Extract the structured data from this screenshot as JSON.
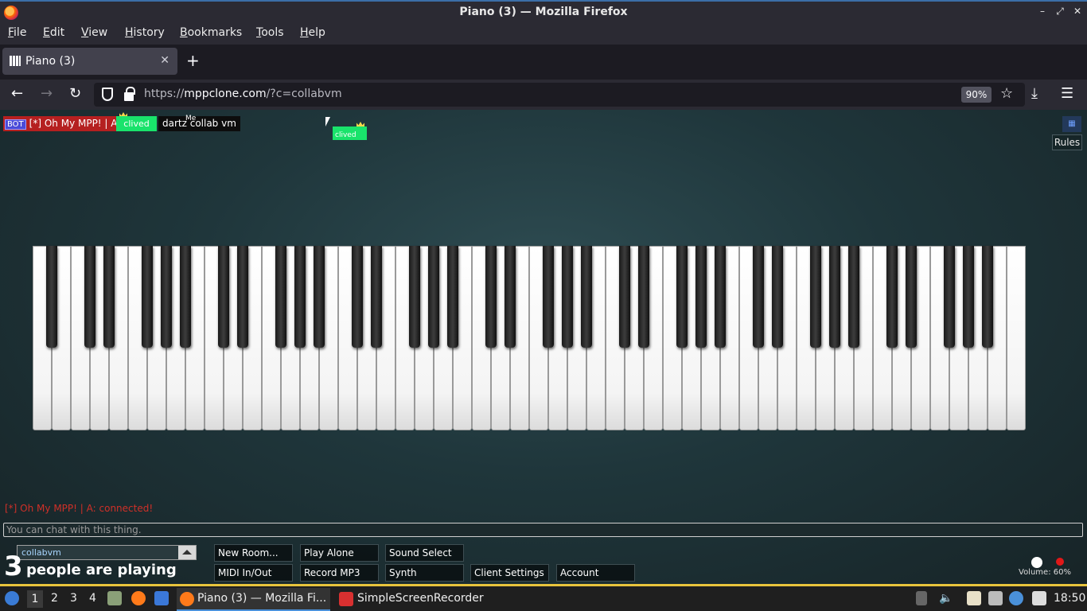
{
  "window": {
    "title": "Piano (3) — Mozilla Firefox"
  },
  "menu": [
    "File",
    "Edit",
    "View",
    "History",
    "Bookmarks",
    "Tools",
    "Help"
  ],
  "tab": {
    "label": "Piano (3)"
  },
  "address": {
    "scheme": "https://",
    "host": "mppclone.com",
    "path": "/?c=collabvm",
    "zoom": "90%"
  },
  "page": {
    "participants": {
      "bot_badge": "BOT",
      "bot_name": "[*] Oh My MPP! | A",
      "user2": "clived",
      "user3": "dartz collab vm",
      "me_label": "Me",
      "cursor_name": "clived"
    },
    "rules_label": "Rules",
    "chat": {
      "last_message_name": "[*] Oh My MPP! | A:",
      "last_message_text": "connected!",
      "input_placeholder": "You can chat with this thing."
    },
    "room": {
      "selected": "collabvm"
    },
    "players": {
      "count": "3",
      "text": "people are playing"
    },
    "buttons": {
      "new_room": "New Room...",
      "play_alone": "Play Alone",
      "sound_select": "Sound Select",
      "midi": "MIDI In/Out",
      "record": "Record MP3",
      "synth": "Synth",
      "client_settings": "Client Settings",
      "account": "Account"
    },
    "volume": {
      "label": "Volume: 60%",
      "level": 0.6
    },
    "piano": {
      "white_keys": 52,
      "black_pattern": [
        1,
        0,
        1,
        1,
        0,
        1,
        1
      ]
    }
  },
  "taskbar": {
    "workspaces": [
      "1",
      "2",
      "3",
      "4"
    ],
    "active_window": "Piano (3) — Mozilla Fi...",
    "other_window": "SimpleScreenRecorder",
    "clock": "18:50"
  }
}
